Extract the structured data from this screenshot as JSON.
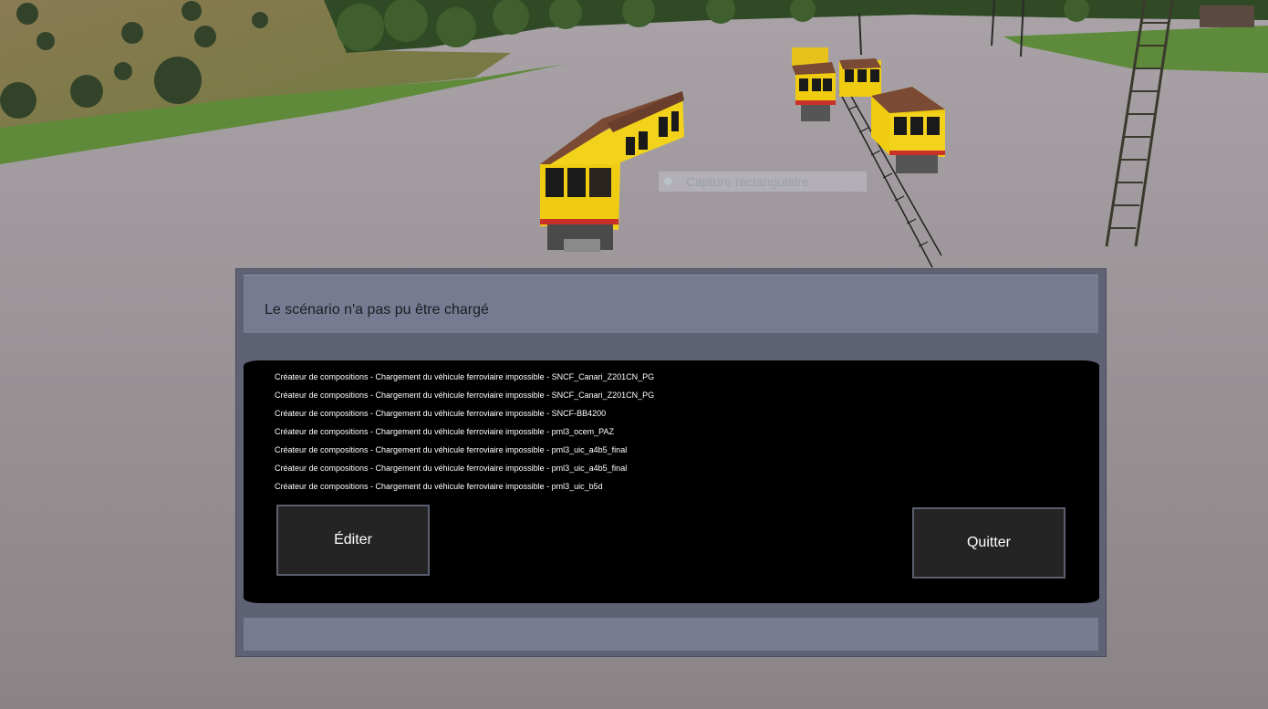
{
  "overlay": {
    "capture_label": "Capture rectangulaire"
  },
  "dialog": {
    "title": "Le scénario n'a pas pu être chargé",
    "errors": [
      "Créateur de compositions - Chargement du véhicule ferroviaire impossible - SNCF_Canari_Z201CN_PG",
      "Créateur de compositions - Chargement du véhicule ferroviaire impossible - SNCF_Canari_Z201CN_PG",
      "Créateur de compositions - Chargement du véhicule ferroviaire impossible - SNCF-BB4200",
      "Créateur de compositions - Chargement du véhicule ferroviaire impossible - pml3_ocem_PAZ",
      "Créateur de compositions - Chargement du véhicule ferroviaire impossible - pml3_uic_a4b5_final",
      "Créateur de compositions - Chargement du véhicule ferroviaire impossible - pml3_uic_a4b5_final",
      "Créateur de compositions - Chargement du véhicule ferroviaire impossible - pml3_uic_b5d"
    ],
    "edit_label": "Éditer",
    "quit_label": "Quitter"
  },
  "colors": {
    "dialog_frame": "#5e6274",
    "dialog_header": "#767b91",
    "dialog_body": "#000000",
    "button_bg": "#242424",
    "train_yellow": "#f3d21c",
    "train_roof": "#7a4a35"
  }
}
